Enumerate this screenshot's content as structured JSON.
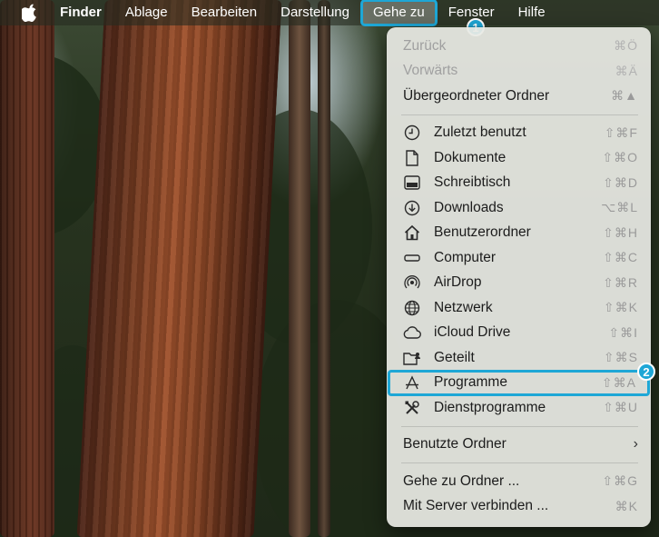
{
  "menubar": {
    "app_name": "Finder",
    "items": [
      "Ablage",
      "Bearbeiten",
      "Darstellung",
      "Gehe zu",
      "Fenster",
      "Hilfe"
    ],
    "active_item": "Gehe zu"
  },
  "badges": [
    "1",
    "2"
  ],
  "menu": {
    "group_nav": [
      {
        "label": "Zurück",
        "shortcut": "⌘Ö",
        "disabled": true
      },
      {
        "label": "Vorwärts",
        "shortcut": "⌘Ä",
        "disabled": true
      },
      {
        "label": "Übergeordneter Ordner",
        "shortcut": "⌘▲",
        "disabled": false
      }
    ],
    "group_places": [
      {
        "label": "Zuletzt benutzt",
        "shortcut": "⇧⌘F",
        "icon": "clock-icon"
      },
      {
        "label": "Dokumente",
        "shortcut": "⇧⌘O",
        "icon": "document-icon"
      },
      {
        "label": "Schreibtisch",
        "shortcut": "⇧⌘D",
        "icon": "desktop-icon"
      },
      {
        "label": "Downloads",
        "shortcut": "⌥⌘L",
        "icon": "download-icon"
      },
      {
        "label": "Benutzerordner",
        "shortcut": "⇧⌘H",
        "icon": "home-icon"
      },
      {
        "label": "Computer",
        "shortcut": "⇧⌘C",
        "icon": "computer-icon"
      },
      {
        "label": "AirDrop",
        "shortcut": "⇧⌘R",
        "icon": "airdrop-icon"
      },
      {
        "label": "Netzwerk",
        "shortcut": "⇧⌘K",
        "icon": "network-icon"
      },
      {
        "label": "iCloud Drive",
        "shortcut": "⇧⌘I",
        "icon": "cloud-icon"
      },
      {
        "label": "Geteilt",
        "shortcut": "⇧⌘S",
        "icon": "shared-folder-icon"
      },
      {
        "label": "Programme",
        "shortcut": "⇧⌘A",
        "icon": "applications-icon",
        "highlighted": true
      },
      {
        "label": "Dienstprogramme",
        "shortcut": "⇧⌘U",
        "icon": "utilities-icon"
      }
    ],
    "recent_folders": {
      "label": "Benutzte Ordner",
      "chevron": "›"
    },
    "group_actions": [
      {
        "label": "Gehe zu Ordner ...",
        "shortcut": "⇧⌘G"
      },
      {
        "label": "Mit Server verbinden ...",
        "shortcut": "⌘K"
      }
    ]
  }
}
